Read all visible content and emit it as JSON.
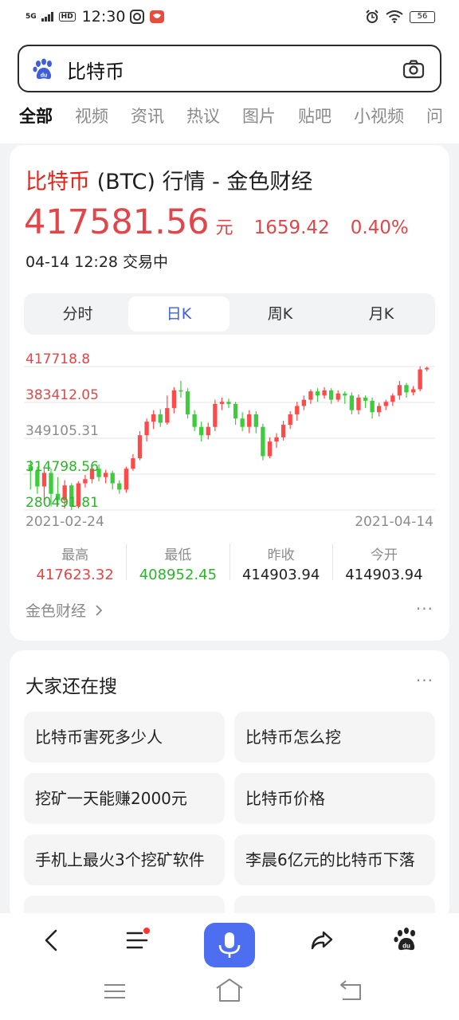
{
  "status_bar": {
    "network": "5G",
    "hd": "HD",
    "time": "12:30",
    "battery": "56"
  },
  "search": {
    "query": "比特币"
  },
  "tabs": [
    "全部",
    "视频",
    "资讯",
    "热议",
    "图片",
    "贴吧",
    "小视频",
    "问"
  ],
  "quote_card": {
    "title_keyword": "比特币",
    "title_rest": " (BTC) 行情 - 金色财经",
    "price": "417581.56",
    "unit": "元",
    "change": "1659.42",
    "change_pct": "0.40%",
    "timestamp": "04-14 12:28 交易中",
    "k_tabs": [
      "分时",
      "日K",
      "周K",
      "月K"
    ],
    "selected_k_tab": "日K",
    "stats": [
      {
        "label": "最高",
        "value": "417623.32",
        "color": "#e0464a"
      },
      {
        "label": "最低",
        "value": "408952.45",
        "color": "#2bb52b"
      },
      {
        "label": "昨收",
        "value": "414903.94",
        "color": "#1f1f1f"
      },
      {
        "label": "今开",
        "value": "414903.94",
        "color": "#1f1f1f"
      }
    ],
    "source": "金色财经",
    "more": "···"
  },
  "chart_data": {
    "type": "candlestick",
    "y_ticks": [
      "417718.8",
      "383412.05",
      "349105.31",
      "314798.56",
      "280491.81"
    ],
    "y_tick_colors": [
      "#e0464a",
      "#e0464a",
      "#8c8c8c",
      "#2bb52b",
      "#2bb52b"
    ],
    "ylim": [
      280491.81,
      417718.8
    ],
    "x_labels": [
      "2021-02-24",
      "2021-04-14"
    ],
    "up_color": "#ff4a4a",
    "down_color": "#3ccc3c",
    "candles": [
      [
        322000,
        318000,
        328000,
        300000
      ],
      [
        318000,
        303000,
        322000,
        296000
      ],
      [
        303000,
        316000,
        320000,
        288000
      ],
      [
        316000,
        296000,
        320000,
        284000
      ],
      [
        296000,
        290000,
        312000,
        285000
      ],
      [
        290000,
        304000,
        309000,
        282000
      ],
      [
        304000,
        284000,
        306000,
        280500
      ],
      [
        284000,
        306000,
        308000,
        282000
      ],
      [
        306000,
        310000,
        314000,
        302000
      ],
      [
        310000,
        320000,
        322000,
        306000
      ],
      [
        320000,
        312000,
        324000,
        308000
      ],
      [
        312000,
        316000,
        319000,
        306000
      ],
      [
        316000,
        306000,
        318000,
        300000
      ],
      [
        306000,
        300000,
        309000,
        296000
      ],
      [
        300000,
        320000,
        322000,
        297000
      ],
      [
        320000,
        330000,
        334000,
        318000
      ],
      [
        330000,
        352000,
        356000,
        328000
      ],
      [
        352000,
        365000,
        368000,
        346000
      ],
      [
        365000,
        372000,
        376000,
        358000
      ],
      [
        372000,
        364000,
        377000,
        360000
      ],
      [
        364000,
        378000,
        390000,
        362000
      ],
      [
        378000,
        395000,
        398000,
        373000
      ],
      [
        395000,
        394000,
        404000,
        388000
      ],
      [
        394000,
        372000,
        397000,
        368000
      ],
      [
        372000,
        360000,
        376000,
        356000
      ],
      [
        360000,
        352000,
        365000,
        346000
      ],
      [
        352000,
        360000,
        364000,
        348000
      ],
      [
        360000,
        382000,
        386000,
        356000
      ],
      [
        382000,
        384000,
        388000,
        376000
      ],
      [
        384000,
        382000,
        387000,
        378000
      ],
      [
        382000,
        368000,
        384000,
        362000
      ],
      [
        368000,
        360000,
        374000,
        356000
      ],
      [
        360000,
        372000,
        376000,
        354000
      ],
      [
        372000,
        360000,
        375000,
        354000
      ],
      [
        360000,
        332000,
        363000,
        328000
      ],
      [
        332000,
        346000,
        350000,
        330000
      ],
      [
        346000,
        350000,
        354000,
        340000
      ],
      [
        350000,
        362000,
        366000,
        347000
      ],
      [
        362000,
        372000,
        375000,
        358000
      ],
      [
        372000,
        380000,
        384000,
        366000
      ],
      [
        380000,
        386000,
        390000,
        376000
      ],
      [
        386000,
        394000,
        396000,
        382000
      ],
      [
        394000,
        390000,
        397000,
        384000
      ],
      [
        390000,
        395000,
        398000,
        387000
      ],
      [
        395000,
        386000,
        397000,
        382000
      ],
      [
        386000,
        392000,
        395000,
        384000
      ],
      [
        392000,
        390000,
        394000,
        382000
      ],
      [
        390000,
        376000,
        393000,
        372000
      ],
      [
        376000,
        388000,
        391000,
        372000
      ],
      [
        388000,
        385000,
        390000,
        378000
      ],
      [
        385000,
        374000,
        388000,
        368000
      ],
      [
        374000,
        380000,
        383000,
        370000
      ],
      [
        380000,
        384000,
        386000,
        376000
      ],
      [
        384000,
        390000,
        392000,
        380000
      ],
      [
        390000,
        400000,
        404000,
        386000
      ],
      [
        400000,
        393000,
        402000,
        388000
      ],
      [
        393000,
        396000,
        399000,
        390000
      ],
      [
        396000,
        415000,
        418000,
        394000
      ],
      [
        415000,
        416500,
        417700,
        413000
      ]
    ]
  },
  "related": {
    "title": "大家还在搜",
    "more": "···",
    "items": [
      "比特币害死多少人",
      "比特币怎么挖",
      "挖矿一天能赚2000元",
      "比特币价格",
      "手机上最火3个挖矿软件",
      "李晨6亿元的比特币下落",
      "",
      ""
    ]
  }
}
